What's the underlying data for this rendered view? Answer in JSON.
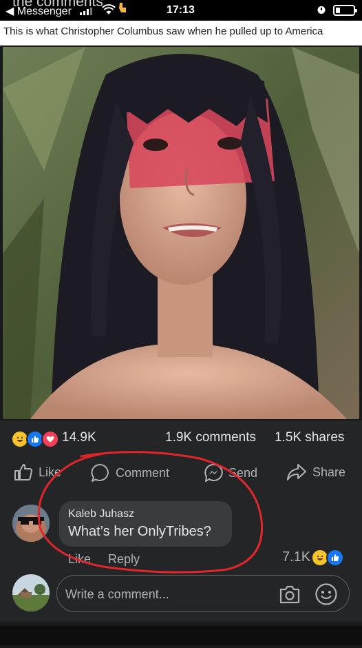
{
  "status_bar": {
    "overlay_text": "the comments",
    "back_label": "◀ Messenger",
    "time": "17:13"
  },
  "post": {
    "caption": "This is what Christopher Columbus saw when he pulled up to America",
    "reactions_count": "14.9K",
    "comments_count": "1.9K comments",
    "shares_count": "1.5K shares",
    "reaction_icons": [
      "haha-icon",
      "like-icon",
      "love-icon"
    ]
  },
  "actions": {
    "like": "Like",
    "comment": "Comment",
    "send": "Send",
    "share": "Share"
  },
  "top_comment": {
    "author": "Kaleb Juhasz",
    "text": "What’s her OnlyTribes?",
    "like_label": "Like",
    "reply_label": "Reply",
    "reaction_count": "7.1K",
    "reaction_icons": [
      "haha-icon",
      "like-icon"
    ]
  },
  "composer": {
    "placeholder": "Write a comment..."
  },
  "colors": {
    "background": "#18191a",
    "card": "#242526",
    "bubble": "#3a3b3c",
    "accent_blue": "#1877f2",
    "annotation_red": "#e0262b"
  }
}
